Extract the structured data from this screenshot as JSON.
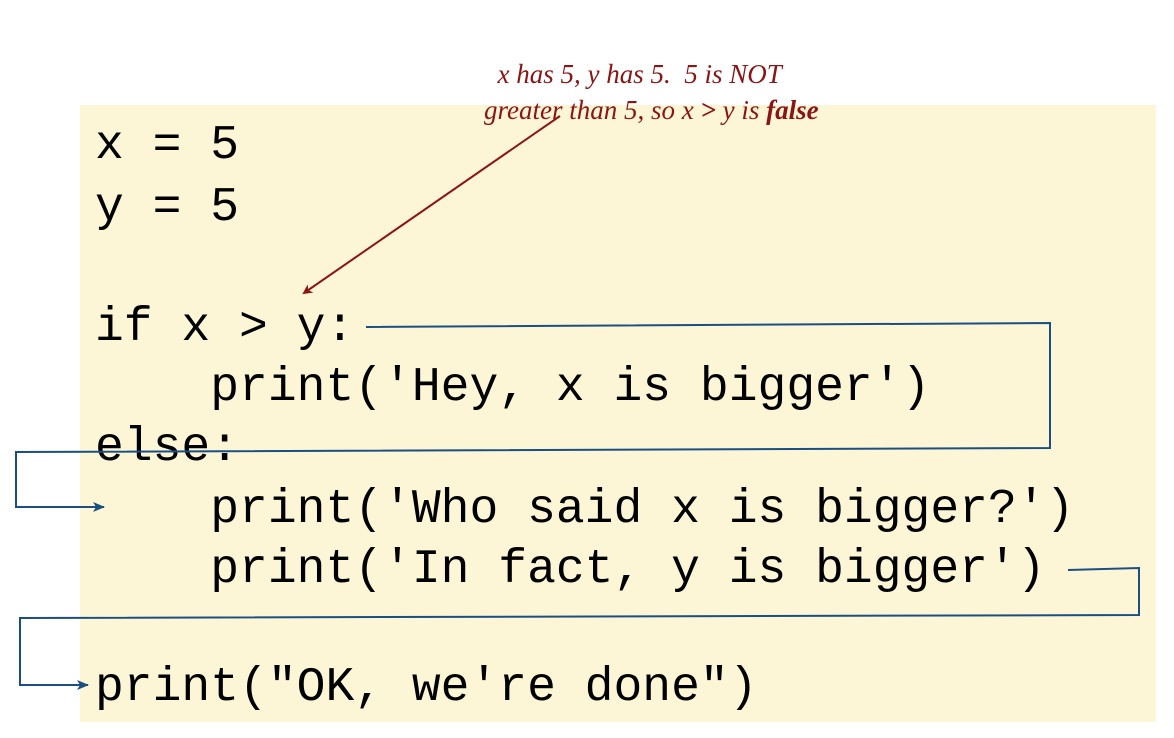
{
  "colors": {
    "code_background": "#fdf6d6",
    "annotation_text": "#8b1414",
    "flow_arrows": "#1b4f82",
    "code_text": "#000000"
  },
  "annotation": {
    "line1": "x has 5, y has 5.  5 is NOT",
    "line2_before_gt": "greater than 5, so x ",
    "gt": ">",
    "line2_after_gt": " y is ",
    "line2_emphasis": "false"
  },
  "code": {
    "lines": [
      "x = 5",
      "y = 5",
      "",
      "if x > y:",
      "    print('Hey, x is bigger')",
      "else:",
      "    print('Who said x is bigger?')",
      "    print('In fact, y is bigger')",
      "",
      "print(\"OK, we're done\")"
    ]
  }
}
